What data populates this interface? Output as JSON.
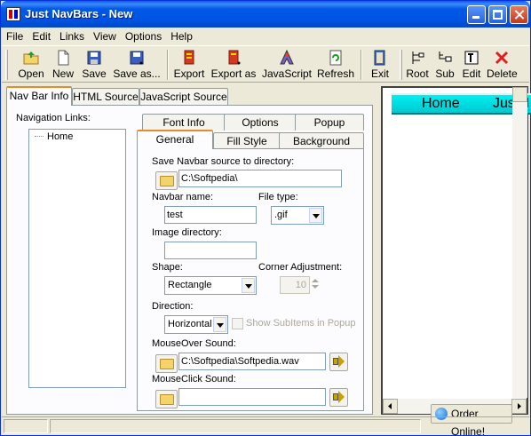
{
  "window": {
    "title": "Just NavBars - New"
  },
  "menu": [
    "File",
    "Edit",
    "Links",
    "View",
    "Options",
    "Help"
  ],
  "toolbar": {
    "open": "Open",
    "new": "New",
    "save": "Save",
    "save_as": "Save as...",
    "export": "Export",
    "export_as": "Export as",
    "javascript": "JavaScript",
    "refresh": "Refresh",
    "exit": "Exit",
    "root": "Root",
    "sub": "Sub",
    "edit": "Edit",
    "delete": "Delete"
  },
  "left_tabs": [
    "Nav Bar Info",
    "HTML Source",
    "JavaScript Source"
  ],
  "nav_links": {
    "label": "Navigation Links:",
    "items": [
      "Home"
    ]
  },
  "settings_tabs": {
    "row1": [
      "Font Info",
      "Options",
      "Popup"
    ],
    "row2": [
      "General",
      "Fill Style",
      "Background"
    ]
  },
  "general": {
    "save_dir_label": "Save Navbar source to directory:",
    "save_dir_value": "C:\\Softpedia\\",
    "navbar_name_label": "Navbar name:",
    "navbar_name_value": "test",
    "file_type_label": "File type:",
    "file_type_value": ".gif",
    "image_dir_label": "Image directory:",
    "image_dir_value": "",
    "shape_label": "Shape:",
    "shape_value": "Rectangle",
    "corner_label": "Corner Adjustment:",
    "corner_value": "10",
    "direction_label": "Direction:",
    "direction_value": "Horizontal",
    "show_subitems_label": "Show SubItems in Popup",
    "show_subitems_checked": false,
    "mouseover_label": "MouseOver Sound:",
    "mouseover_value": "C:\\Softpedia\\Softpedia.wav",
    "mouseclick_label": "MouseClick Sound:",
    "mouseclick_value": ""
  },
  "preview": {
    "item1": "Home",
    "item2": "JustN"
  },
  "order_button": "Order Online!",
  "colors": {
    "titlebar": "#0054e3",
    "preview_bar": "#00e0e8",
    "tab_highlight": "#e68b2c"
  }
}
